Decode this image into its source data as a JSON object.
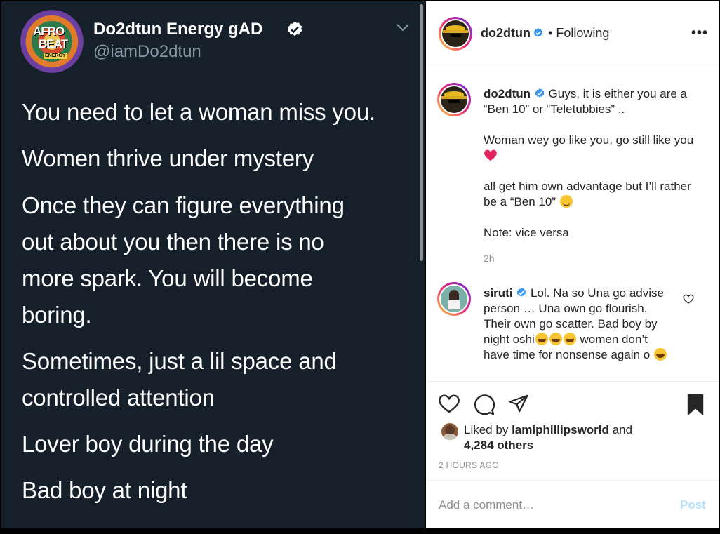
{
  "tweet": {
    "avatar_text": [
      "AFRO",
      "BEAT",
      "ENERGY"
    ],
    "name": "Do2dtun Energy gAD",
    "handle": "@iamDo2dtun",
    "lines": [
      "You need to let a woman miss you.",
      "Women thrive under mystery",
      "Once they can figure everything",
      "out about you then there is no",
      "more spark. You will become",
      "boring.",
      "Sometimes, just a lil space and",
      "controlled attention",
      "Lover boy during the day",
      "Bad boy at night"
    ]
  },
  "instagram": {
    "header": {
      "username": "do2dtun",
      "separator": "•",
      "status": "Following",
      "more": "•••"
    },
    "caption": {
      "username": "do2dtun",
      "text1": "Guys, it is either you are a “Ben 10” or “Teletubbies” ..",
      "text2": "Woman wey go like you, go still like you",
      "text3": "all get him own advantage but I’ll rather be a “Ben 10”",
      "text4": "Note: vice versa",
      "time": "2h"
    },
    "comment": {
      "username": "siruti",
      "text_a": "Lol. Na so Una go advise person … Una own go flourish. Their own go scatter. Bad boy by night oshi",
      "text_b": "women don’t have time for nonsense again o"
    },
    "likes": {
      "prefix": "Liked by",
      "user": "lamiphillipsworld",
      "and": "and",
      "count": "4,284 others"
    },
    "posted_ago": "2 HOURS AGO",
    "comment_input": {
      "placeholder": "Add a comment…",
      "post_label": "Post"
    },
    "colors": {
      "tweet_bg": "#15202b",
      "verified": "#1da1f2",
      "ig_verified": "#3897f0",
      "post_disabled": "#b2dffc"
    }
  }
}
